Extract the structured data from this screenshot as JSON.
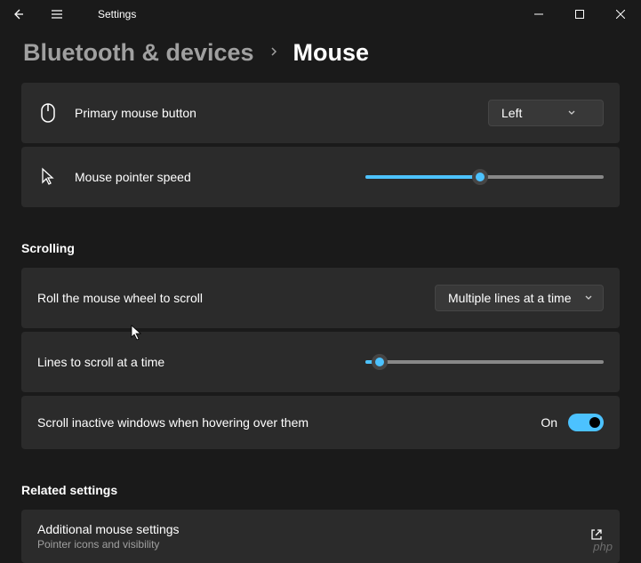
{
  "app": {
    "title": "Settings"
  },
  "breadcrumb": {
    "parent": "Bluetooth & devices",
    "current": "Mouse"
  },
  "settings": {
    "primary_button": {
      "label": "Primary mouse button",
      "value": "Left"
    },
    "pointer_speed": {
      "label": "Mouse pointer speed",
      "value": 48
    }
  },
  "scrolling": {
    "header": "Scrolling",
    "roll_wheel": {
      "label": "Roll the mouse wheel to scroll",
      "value": "Multiple lines at a time"
    },
    "lines_at_time": {
      "label": "Lines to scroll at a time",
      "value": 6
    },
    "scroll_inactive": {
      "label": "Scroll inactive windows when hovering over them",
      "state": "On",
      "value": true
    }
  },
  "related": {
    "header": "Related settings",
    "additional": {
      "title": "Additional mouse settings",
      "subtitle": "Pointer icons and visibility"
    }
  },
  "watermark": "php"
}
